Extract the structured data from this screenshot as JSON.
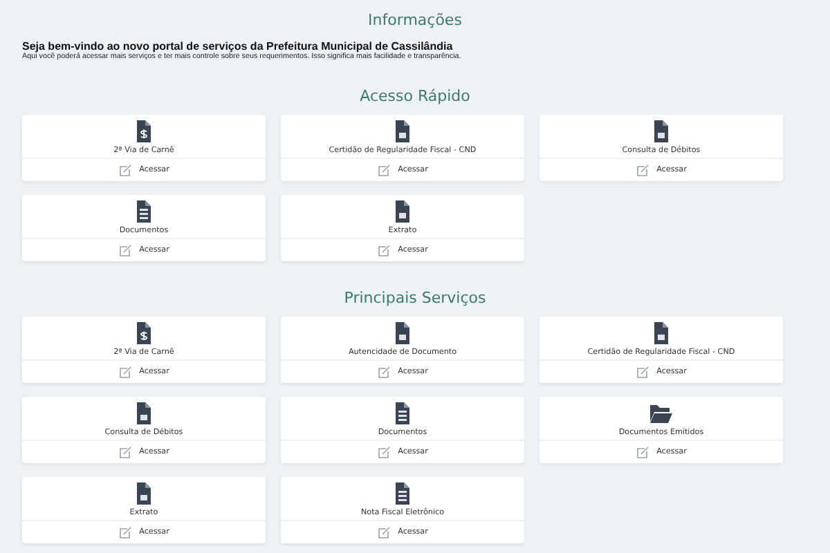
{
  "info": {
    "title": "Informações",
    "headline": "Seja bem-vindo ao novo portal de serviços da Prefeitura Municipal de Cassilândia",
    "text": "Aqui você poderá acessar mais serviços e ter mais controle sobre seus requerimentos. Isso significa mais facilidade e transparência."
  },
  "sections": [
    {
      "title": "Acesso Rápido",
      "cards": [
        {
          "label": "2ª Via de Carnê",
          "kind": "invoice",
          "action": "Acessar"
        },
        {
          "label": "Certidão de Regularidade Fiscal - CND",
          "kind": "document",
          "action": "Acessar"
        },
        {
          "label": "Consulta de Débitos",
          "kind": "document",
          "action": "Acessar"
        },
        {
          "label": "Documentos",
          "kind": "list",
          "action": "Acessar"
        },
        {
          "label": "Extrato",
          "kind": "document",
          "action": "Acessar"
        }
      ]
    },
    {
      "title": "Principais Serviços",
      "cards": [
        {
          "label": "2ª Via de Carnê",
          "kind": "invoice",
          "action": "Acessar"
        },
        {
          "label": "Autencidade de Documento",
          "kind": "document",
          "action": "Acessar"
        },
        {
          "label": "Certidão de Regularidade Fiscal - CND",
          "kind": "document",
          "action": "Acessar"
        },
        {
          "label": "Consulta de Débitos",
          "kind": "document",
          "action": "Acessar"
        },
        {
          "label": "Documentos",
          "kind": "list",
          "action": "Acessar"
        },
        {
          "label": "Documentos Emitidos",
          "kind": "folder",
          "action": "Acessar"
        },
        {
          "label": "Extrato",
          "kind": "document",
          "action": "Acessar"
        },
        {
          "label": "Nota Fiscal Eletrônico",
          "kind": "list",
          "action": "Acessar"
        }
      ]
    }
  ]
}
